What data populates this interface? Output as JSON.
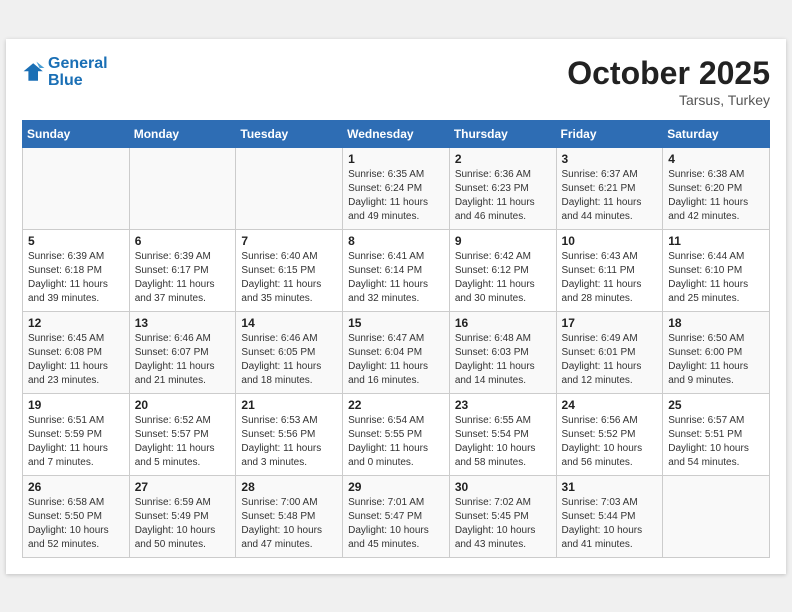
{
  "header": {
    "logo_line1": "General",
    "logo_line2": "Blue",
    "month": "October 2025",
    "location": "Tarsus, Turkey"
  },
  "weekdays": [
    "Sunday",
    "Monday",
    "Tuesday",
    "Wednesday",
    "Thursday",
    "Friday",
    "Saturday"
  ],
  "weeks": [
    [
      {
        "day": "",
        "info": ""
      },
      {
        "day": "",
        "info": ""
      },
      {
        "day": "",
        "info": ""
      },
      {
        "day": "1",
        "info": "Sunrise: 6:35 AM\nSunset: 6:24 PM\nDaylight: 11 hours\nand 49 minutes."
      },
      {
        "day": "2",
        "info": "Sunrise: 6:36 AM\nSunset: 6:23 PM\nDaylight: 11 hours\nand 46 minutes."
      },
      {
        "day": "3",
        "info": "Sunrise: 6:37 AM\nSunset: 6:21 PM\nDaylight: 11 hours\nand 44 minutes."
      },
      {
        "day": "4",
        "info": "Sunrise: 6:38 AM\nSunset: 6:20 PM\nDaylight: 11 hours\nand 42 minutes."
      }
    ],
    [
      {
        "day": "5",
        "info": "Sunrise: 6:39 AM\nSunset: 6:18 PM\nDaylight: 11 hours\nand 39 minutes."
      },
      {
        "day": "6",
        "info": "Sunrise: 6:39 AM\nSunset: 6:17 PM\nDaylight: 11 hours\nand 37 minutes."
      },
      {
        "day": "7",
        "info": "Sunrise: 6:40 AM\nSunset: 6:15 PM\nDaylight: 11 hours\nand 35 minutes."
      },
      {
        "day": "8",
        "info": "Sunrise: 6:41 AM\nSunset: 6:14 PM\nDaylight: 11 hours\nand 32 minutes."
      },
      {
        "day": "9",
        "info": "Sunrise: 6:42 AM\nSunset: 6:12 PM\nDaylight: 11 hours\nand 30 minutes."
      },
      {
        "day": "10",
        "info": "Sunrise: 6:43 AM\nSunset: 6:11 PM\nDaylight: 11 hours\nand 28 minutes."
      },
      {
        "day": "11",
        "info": "Sunrise: 6:44 AM\nSunset: 6:10 PM\nDaylight: 11 hours\nand 25 minutes."
      }
    ],
    [
      {
        "day": "12",
        "info": "Sunrise: 6:45 AM\nSunset: 6:08 PM\nDaylight: 11 hours\nand 23 minutes."
      },
      {
        "day": "13",
        "info": "Sunrise: 6:46 AM\nSunset: 6:07 PM\nDaylight: 11 hours\nand 21 minutes."
      },
      {
        "day": "14",
        "info": "Sunrise: 6:46 AM\nSunset: 6:05 PM\nDaylight: 11 hours\nand 18 minutes."
      },
      {
        "day": "15",
        "info": "Sunrise: 6:47 AM\nSunset: 6:04 PM\nDaylight: 11 hours\nand 16 minutes."
      },
      {
        "day": "16",
        "info": "Sunrise: 6:48 AM\nSunset: 6:03 PM\nDaylight: 11 hours\nand 14 minutes."
      },
      {
        "day": "17",
        "info": "Sunrise: 6:49 AM\nSunset: 6:01 PM\nDaylight: 11 hours\nand 12 minutes."
      },
      {
        "day": "18",
        "info": "Sunrise: 6:50 AM\nSunset: 6:00 PM\nDaylight: 11 hours\nand 9 minutes."
      }
    ],
    [
      {
        "day": "19",
        "info": "Sunrise: 6:51 AM\nSunset: 5:59 PM\nDaylight: 11 hours\nand 7 minutes."
      },
      {
        "day": "20",
        "info": "Sunrise: 6:52 AM\nSunset: 5:57 PM\nDaylight: 11 hours\nand 5 minutes."
      },
      {
        "day": "21",
        "info": "Sunrise: 6:53 AM\nSunset: 5:56 PM\nDaylight: 11 hours\nand 3 minutes."
      },
      {
        "day": "22",
        "info": "Sunrise: 6:54 AM\nSunset: 5:55 PM\nDaylight: 11 hours\nand 0 minutes."
      },
      {
        "day": "23",
        "info": "Sunrise: 6:55 AM\nSunset: 5:54 PM\nDaylight: 10 hours\nand 58 minutes."
      },
      {
        "day": "24",
        "info": "Sunrise: 6:56 AM\nSunset: 5:52 PM\nDaylight: 10 hours\nand 56 minutes."
      },
      {
        "day": "25",
        "info": "Sunrise: 6:57 AM\nSunset: 5:51 PM\nDaylight: 10 hours\nand 54 minutes."
      }
    ],
    [
      {
        "day": "26",
        "info": "Sunrise: 6:58 AM\nSunset: 5:50 PM\nDaylight: 10 hours\nand 52 minutes."
      },
      {
        "day": "27",
        "info": "Sunrise: 6:59 AM\nSunset: 5:49 PM\nDaylight: 10 hours\nand 50 minutes."
      },
      {
        "day": "28",
        "info": "Sunrise: 7:00 AM\nSunset: 5:48 PM\nDaylight: 10 hours\nand 47 minutes."
      },
      {
        "day": "29",
        "info": "Sunrise: 7:01 AM\nSunset: 5:47 PM\nDaylight: 10 hours\nand 45 minutes."
      },
      {
        "day": "30",
        "info": "Sunrise: 7:02 AM\nSunset: 5:45 PM\nDaylight: 10 hours\nand 43 minutes."
      },
      {
        "day": "31",
        "info": "Sunrise: 7:03 AM\nSunset: 5:44 PM\nDaylight: 10 hours\nand 41 minutes."
      },
      {
        "day": "",
        "info": ""
      }
    ]
  ]
}
